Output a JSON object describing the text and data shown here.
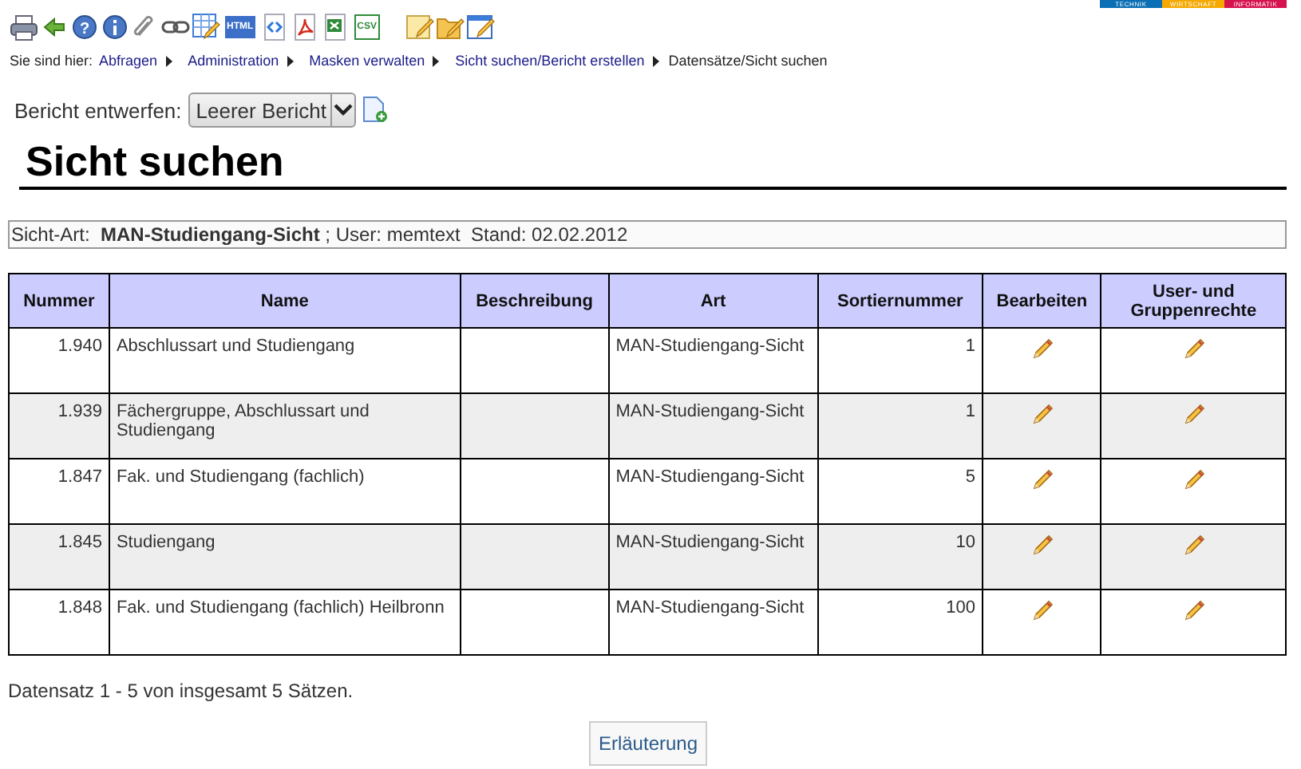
{
  "logo": [
    {
      "label": "TECHNIK",
      "color": "#0a6fb4"
    },
    {
      "label": "WIRTSCHAFT",
      "color": "#f5a800"
    },
    {
      "label": "INFORMATIK",
      "color": "#d5134f"
    }
  ],
  "toolbar": [
    {
      "kind": "print"
    },
    {
      "kind": "back"
    },
    {
      "kind": "help",
      "label": "?"
    },
    {
      "kind": "info"
    },
    {
      "kind": "clip"
    },
    {
      "kind": "link"
    },
    {
      "kind": "table-edit"
    },
    {
      "kind": "html",
      "label": "HTML"
    },
    {
      "kind": "xml"
    },
    {
      "kind": "pdf"
    },
    {
      "kind": "excel"
    },
    {
      "kind": "csv",
      "label": "CSV"
    },
    {
      "kind": "gap"
    },
    {
      "kind": "note-edit"
    },
    {
      "kind": "folder-edit"
    },
    {
      "kind": "window-edit"
    }
  ],
  "breadcrumb": {
    "prefix": "Sie sind hier:",
    "links": [
      "Abfragen",
      "Administration",
      "Masken verwalten",
      "Sicht suchen/Bericht erstellen"
    ],
    "current": "Datensätze/Sicht suchen"
  },
  "report": {
    "label": "Bericht entwerfen:",
    "value": "Leerer Bericht"
  },
  "title": "Sicht suchen",
  "info": "Sicht-Art:  **MAN-Studiengang-Sicht** ; User: memtext  Stand: 02.02.2012",
  "table": {
    "columns": [
      "Nummer",
      "Name",
      "Beschreibung",
      "Art",
      "Sortiernummer",
      "Bearbeiten",
      "User- und Gruppenrechte"
    ],
    "rows": [
      {
        "nummer": "1.940",
        "name": "Abschlussart und Studiengang",
        "art": "MAN-Studiengang-Sicht",
        "sort": "1"
      },
      {
        "nummer": "1.939",
        "name": "Fächergruppe, Abschlussart und Studiengang",
        "art": "MAN-Studiengang-Sicht",
        "sort": "1"
      },
      {
        "nummer": "1.847",
        "name": "Fak. und Studiengang (fachlich)",
        "art": "MAN-Studiengang-Sicht",
        "sort": "5"
      },
      {
        "nummer": "1.845",
        "name": "Studiengang",
        "art": "MAN-Studiengang-Sicht",
        "sort": "10"
      },
      {
        "nummer": "1.848",
        "name": "Fak. und Studiengang (fachlich) Heilbronn",
        "art": "MAN-Studiengang-Sicht",
        "sort": "100"
      }
    ]
  },
  "summary": "Datensatz 1 - 5 von insgesamt 5 Sätzen.",
  "button": "Erläuterung"
}
